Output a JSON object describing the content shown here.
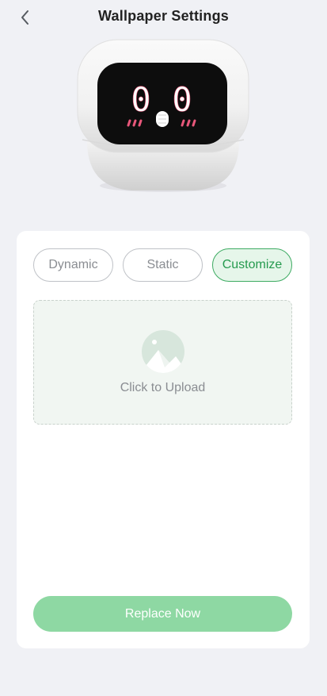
{
  "header": {
    "title": "Wallpaper Settings",
    "back_icon": "chevron-left-icon"
  },
  "device_preview": {
    "image": "robot-device-face",
    "face_text": "0_0"
  },
  "tabs": [
    {
      "label": "Dynamic",
      "active": false
    },
    {
      "label": "Static",
      "active": false
    },
    {
      "label": "Customize",
      "active": true
    }
  ],
  "upload": {
    "label": "Click to Upload",
    "icon": "image-upload-icon"
  },
  "actions": {
    "replace_label": "Replace Now"
  },
  "colors": {
    "background": "#f0f1f5",
    "accent": "#3dab62",
    "accent_light": "#e6f6ea",
    "button": "#8ed8a3",
    "face_pink": "#e8577a"
  }
}
